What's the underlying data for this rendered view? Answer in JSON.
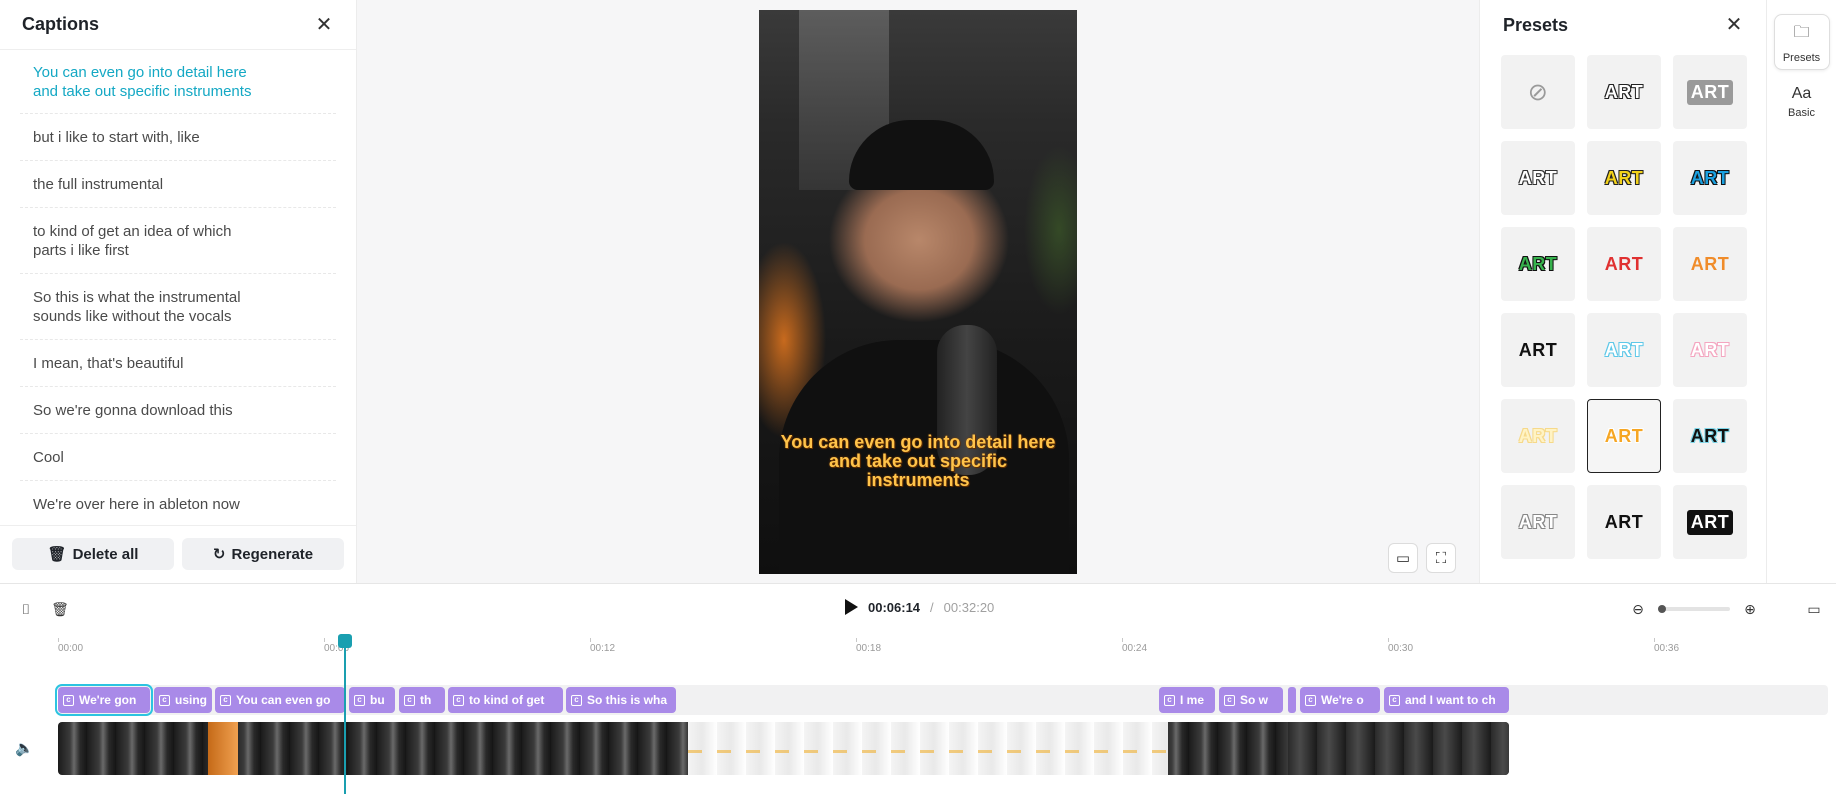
{
  "captions_panel": {
    "title": "Captions",
    "items": [
      "You can even go into detail here and take out specific instruments",
      "but i like to start with, like",
      "the full instrumental",
      "to kind of get an idea of which parts i like first",
      "So this is what the instrumental sounds like without the vocals",
      "I mean, that's beautiful",
      "So we're gonna download this",
      "Cool",
      "We're over here in ableton now"
    ],
    "active_index": 0,
    "delete_all_label": "Delete all",
    "regenerate_label": "Regenerate"
  },
  "preview": {
    "caption_text": "You can even go into detail here and take out specific instruments",
    "caption_color": "#ffc34a"
  },
  "presets_panel": {
    "title": "Presets",
    "items": [
      {
        "label": "",
        "icon": "none-icon",
        "color": "#9a9a9a"
      },
      {
        "label": "ART",
        "color": "#ffffff",
        "stroke": "#222222"
      },
      {
        "label": "ART",
        "color": "#ffffff",
        "bg": "#9a9a9a"
      },
      {
        "label": "ART",
        "color": "#ffffff",
        "stroke": "#333333"
      },
      {
        "label": "ART",
        "color": "#f3d21a",
        "stroke": "#222222"
      },
      {
        "label": "ART",
        "color": "#1aa0e0",
        "stroke": "#111111"
      },
      {
        "label": "ART",
        "color": "#37b24d",
        "stroke": "#111111"
      },
      {
        "label": "ART",
        "color": "#e03131"
      },
      {
        "label": "ART",
        "color": "#f08c2a"
      },
      {
        "label": "ART",
        "color": "#111111"
      },
      {
        "label": "ART",
        "color": "#ffffff",
        "stroke": "#5ec8e8"
      },
      {
        "label": "ART",
        "color": "#ffffff",
        "stroke": "#f4a6c0"
      },
      {
        "label": "ART",
        "color": "#fff3c4",
        "stroke": "#f6d98a"
      },
      {
        "label": "ART",
        "color": "#f6a623",
        "stroke": "#ffffff"
      },
      {
        "label": "ART",
        "color": "#111111",
        "stroke": "#7fd6e8"
      },
      {
        "label": "ART",
        "color": "#ffffff",
        "stroke": "#888888"
      },
      {
        "label": "ART",
        "color": "#111111"
      },
      {
        "label": "ART",
        "color": "#ffffff",
        "bg": "#111111"
      }
    ],
    "selected_index": 13
  },
  "rail": {
    "items": [
      {
        "label": "Presets",
        "icon": "folder-icon",
        "active": true
      },
      {
        "label": "Basic",
        "icon": "Aa",
        "active": false
      }
    ]
  },
  "timeline": {
    "current_time": "00:06:14",
    "separator": "/",
    "total_time": "00:32:20",
    "ruler": [
      "00:00",
      "00:06",
      "00:12",
      "00:18",
      "00:24",
      "00:30",
      "00:36"
    ],
    "caption_clips": [
      "We're gon",
      "using",
      "You can even go",
      "bu",
      "th",
      "to kind of get",
      "So this is wha",
      "I me",
      "So w",
      "We're o",
      "and I want to ch"
    ],
    "selected_clip_index": 0,
    "accent_color": "#1a9fb0",
    "clip_color": "#a98ae8"
  }
}
